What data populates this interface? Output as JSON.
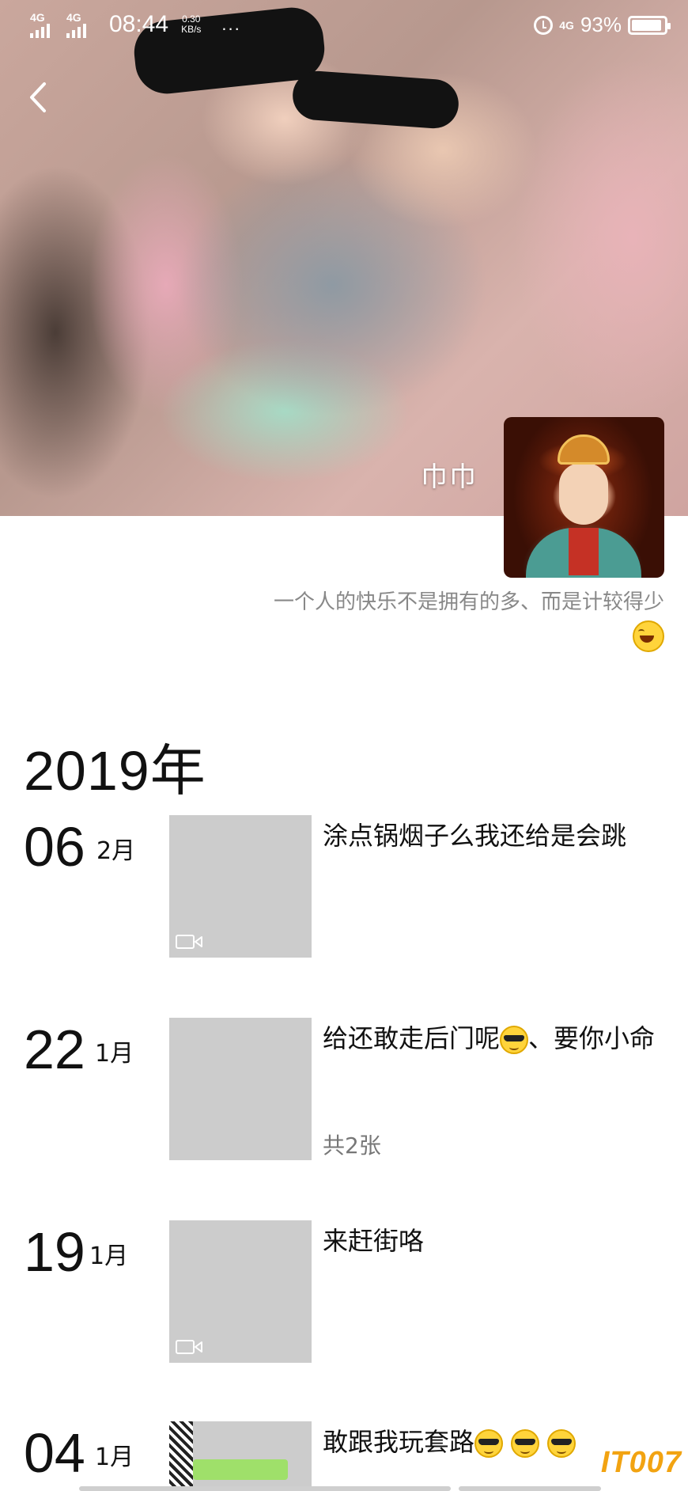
{
  "status_bar": {
    "network_1": "4G",
    "network_2": "4G",
    "time": "08:44",
    "speed_value": "0.30",
    "speed_unit": "KB/s",
    "more": "...",
    "right_network": "4G",
    "battery": "93%",
    "battery_level": 0.93
  },
  "profile": {
    "name": "巾巾",
    "signature": "一个人的快乐不是拥有的多、而是计较得少"
  },
  "timeline": {
    "year": "2019年",
    "posts": [
      {
        "day": "06",
        "month": "2月",
        "text": "涂点锅烟子么我还给是会跳",
        "has_video": true,
        "count": ""
      },
      {
        "day": "22",
        "month": "1月",
        "text_before": "给还敢走后门呢",
        "text_after": "、要你小命",
        "has_video": false,
        "count": "共2张"
      },
      {
        "day": "19",
        "month": "1月",
        "text": "来赶街咯",
        "has_video": true,
        "count": ""
      },
      {
        "day": "04",
        "month": "1月",
        "text": "敢跟我玩套路",
        "has_video": false,
        "count": ""
      }
    ]
  },
  "watermark": "IT007",
  "colors": {
    "text_primary": "#111111",
    "text_secondary": "#888888",
    "watermark": "#f2a311"
  },
  "icons": [
    "back-arrow-icon",
    "alarm-icon",
    "battery-icon",
    "signal-icon",
    "video-icon",
    "laughing-emoji-icon",
    "sunglasses-emoji-icon"
  ]
}
